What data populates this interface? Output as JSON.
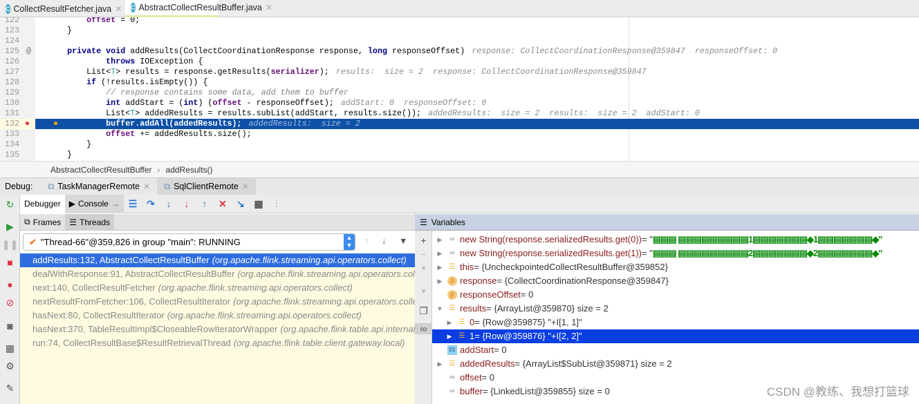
{
  "file_tabs": [
    {
      "label": "CollectResultFetcher.java",
      "active": false
    },
    {
      "label": "AbstractCollectResultBuffer.java",
      "active": true
    }
  ],
  "code_lines": [
    {
      "n": "122",
      "tokens": [
        [
          "        ",
          ""
        ],
        [
          "offset",
          "fd"
        ],
        [
          " = 0;",
          ""
        ]
      ]
    },
    {
      "n": "123",
      "tokens": [
        [
          "    }",
          ""
        ]
      ]
    },
    {
      "n": "124",
      "tokens": []
    },
    {
      "n": "125",
      "tokens": [
        [
          "    ",
          ""
        ],
        [
          "private void",
          "kw"
        ],
        [
          " addResults(CollectCoordinationResponse response, ",
          ""
        ],
        [
          "long",
          "kw"
        ],
        [
          " responseOffset)",
          ""
        ]
      ],
      "hint": "response: CollectCoordinationResponse@359847  responseOffset: 0"
    },
    {
      "n": "126",
      "tokens": [
        [
          "            ",
          ""
        ],
        [
          "throws",
          "kw"
        ],
        [
          " IOException {",
          ""
        ]
      ]
    },
    {
      "n": "127",
      "tokens": [
        [
          "        List<",
          ""
        ],
        [
          "T",
          "tp"
        ],
        [
          "> results = response.getResults(",
          ""
        ],
        [
          "serializer",
          "fd"
        ],
        [
          ");",
          ""
        ]
      ],
      "hint": "results:  size = 2  response: CollectCoordinationResponse@359847"
    },
    {
      "n": "128",
      "tokens": [
        [
          "        ",
          ""
        ],
        [
          "if",
          "kw"
        ],
        [
          " (!results.isEmpty()) {",
          ""
        ]
      ]
    },
    {
      "n": "129",
      "tokens": [
        [
          "            ",
          ""
        ],
        [
          "// response contains some data, add them to buffer",
          "cm"
        ]
      ]
    },
    {
      "n": "130",
      "tokens": [
        [
          "            ",
          ""
        ],
        [
          "int",
          "kw"
        ],
        [
          " addStart = (",
          ""
        ],
        [
          "int",
          "kw"
        ],
        [
          ") (",
          ""
        ],
        [
          "offset",
          "fd"
        ],
        [
          " - responseOffset);",
          ""
        ]
      ],
      "hint": "addStart: 0  responseOffset: 0"
    },
    {
      "n": "131",
      "tokens": [
        [
          "            List<",
          ""
        ],
        [
          "T",
          "tp"
        ],
        [
          "> addedResults = results.subList(addStart, results.size());",
          ""
        ]
      ],
      "hint": "addedResults:  size = 2  results:  size = 2  addStart: 0"
    },
    {
      "n": "132",
      "tokens": [
        [
          "            buffer.addAll(addedResults);",
          ""
        ]
      ],
      "hint": "addedResults:  size = 2",
      "current": true
    },
    {
      "n": "133",
      "tokens": [
        [
          "            ",
          ""
        ],
        [
          "offset",
          "fd"
        ],
        [
          " += addedResults.size();",
          ""
        ]
      ]
    },
    {
      "n": "134",
      "tokens": [
        [
          "        }",
          ""
        ]
      ]
    },
    {
      "n": "135",
      "tokens": [
        [
          "    }",
          ""
        ]
      ]
    }
  ],
  "breadcrumb": [
    "AbstractCollectResultBuffer",
    "addResults()"
  ],
  "debug": {
    "label": "Debug:",
    "sessions": [
      {
        "label": "TaskManagerRemote",
        "active": false
      },
      {
        "label": "SqlClientRemote",
        "active": true
      }
    ]
  },
  "toolbar": {
    "debugger": "Debugger",
    "console": "Console"
  },
  "frames_panel": {
    "frames_tab": "Frames",
    "threads_tab": "Threads",
    "thread": "\"Thread-66\"@359,826 in group \"main\": RUNNING"
  },
  "frames": [
    {
      "method": "addResults:132, AbstractCollectResultBuffer",
      "pkg": "(org.apache.flink.streaming.api.operators.collect)",
      "selected": true
    },
    {
      "method": "dealWithResponse:91, AbstractCollectResultBuffer",
      "pkg": "(org.apache.flink.streaming.api.operators.collect)"
    },
    {
      "method": "next:140, CollectResultFetcher",
      "pkg": "(org.apache.flink.streaming.api.operators.collect)"
    },
    {
      "method": "nextResultFromFetcher:106, CollectResultIterator",
      "pkg": "(org.apache.flink.streaming.api.operators.collect)"
    },
    {
      "method": "hasNext:80, CollectResultIterator",
      "pkg": "(org.apache.flink.streaming.api.operators.collect)"
    },
    {
      "method": "hasNext:370, TableResultImpl$CloseableRowIteratorWrapper",
      "pkg": "(org.apache.flink.table.api.internal)"
    },
    {
      "method": "run:74, CollectResultBase$ResultRetrievalThread",
      "pkg": "(org.apache.flink.table.client.gateway.local)"
    }
  ],
  "variables_title": "Variables",
  "variables": [
    {
      "expand": "right",
      "icon": "watch",
      "name": "new String(response.serializedResults.get(0))",
      "value": " = \"",
      "green": "▤▤▤ ▤▤▤▤▤▤▤▤▤1▤▤▤▤▤▤▤◆1▤▤▤▤▤▤▤◆\"",
      "indent": 0
    },
    {
      "expand": "right",
      "icon": "watch",
      "name": "new String(response.serializedResults.get(1))",
      "value": " = \"",
      "green": "▤▤▤ ▤▤▤▤▤▤▤▤▤2▤▤▤▤▤▤▤◆2▤▤▤▤▤▤▤◆\"",
      "indent": 0
    },
    {
      "expand": "right",
      "icon": "field",
      "name": "this",
      "value": " = {UncheckpointedCollectResultBuffer@359852}",
      "indent": 0
    },
    {
      "expand": "right",
      "icon": "param",
      "name": "response",
      "value": " = {CollectCoordinationResponse@359847}",
      "indent": 0
    },
    {
      "expand": "none",
      "icon": "param",
      "name": "responseOffset",
      "value": " = 0",
      "indent": 0
    },
    {
      "expand": "down",
      "icon": "field",
      "name": "results",
      "value": " = {ArrayList@359870}  size = 2",
      "indent": 0
    },
    {
      "expand": "right",
      "icon": "field",
      "name": "0",
      "value": " = {Row@359875} \"+I[1, 1]\"",
      "indent": 1
    },
    {
      "expand": "right",
      "icon": "field",
      "name": "1",
      "value": " = {Row@359876} \"+I[2, 2]\"",
      "indent": 1,
      "selected": true
    },
    {
      "expand": "none",
      "icon": "primitive",
      "name": "addStart",
      "value": " = 0",
      "indent": 0
    },
    {
      "expand": "right",
      "icon": "field",
      "name": "addedResults",
      "value": " = {ArrayList$SubList@359871}  size = 2",
      "indent": 0
    },
    {
      "expand": "none",
      "icon": "watch",
      "name": "offset",
      "value": " = 0",
      "indent": 0
    },
    {
      "expand": "none",
      "icon": "watch",
      "name": "buffer",
      "value": " = {LinkedList@359855}  size = 0",
      "indent": 0
    }
  ],
  "watermark": "CSDN @教练、我想打篮球",
  "colors": {
    "current_line": "#0d50a6",
    "selected_frame": "#2e6de0",
    "selected_var": "#0b3ee0",
    "frames_bg": "#fffbe0"
  }
}
